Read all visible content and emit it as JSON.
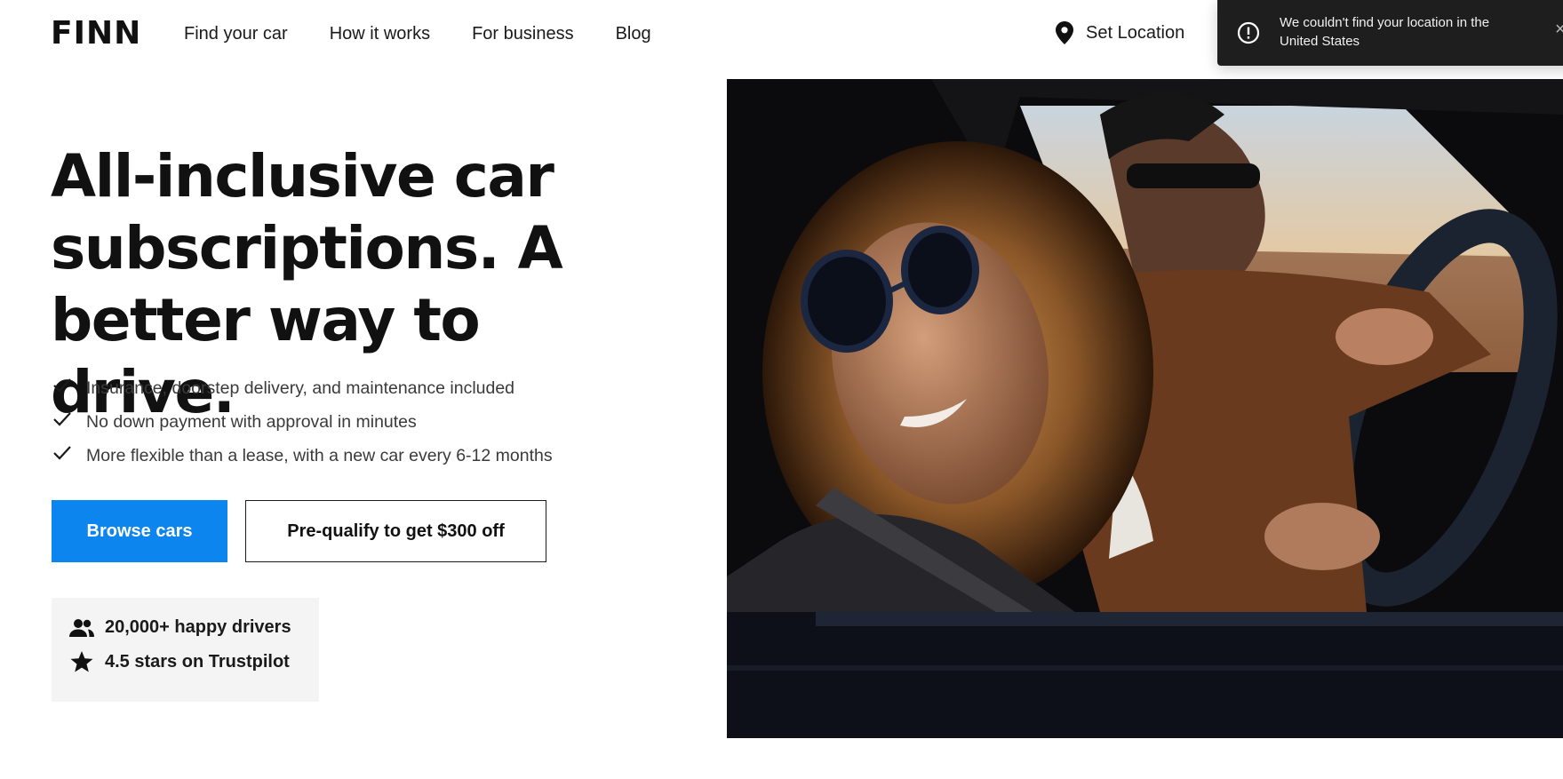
{
  "header": {
    "logo": "FINN",
    "nav": [
      "Find your car",
      "How it works",
      "For business",
      "Blog"
    ],
    "location_label": "Set Location"
  },
  "toast": {
    "message": "We couldn't find your location in the United States",
    "close": "×"
  },
  "hero": {
    "title": "All-inclusive car subscriptions. A better way to drive.",
    "bullets": [
      "Insurance, doorstep delivery, and maintenance included",
      "No down payment with approval in minutes",
      "More flexible than a lease, with a new car every 6-12 months"
    ],
    "primary_cta": "Browse cars",
    "secondary_cta": "Pre-qualify to get $300 off"
  },
  "stats": {
    "drivers": "20,000+ happy drivers",
    "rating": "4.5 stars on Trustpilot"
  },
  "colors": {
    "accent": "#0d85ee",
    "toast_bg": "#1e1e1e",
    "stats_bg": "#f4f4f4"
  },
  "icons": {
    "location": "map-pin-icon",
    "toast": "alert-circle-icon",
    "check": "check-icon",
    "drivers": "people-icon",
    "rating": "star-icon"
  }
}
